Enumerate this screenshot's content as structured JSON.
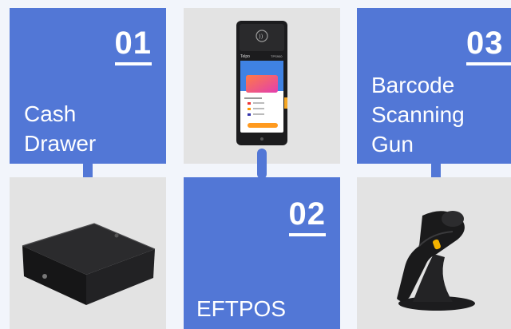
{
  "items": [
    {
      "number": "01",
      "title_lines": [
        "Cash",
        "Drawer"
      ],
      "image": "cash-drawer"
    },
    {
      "number": "02",
      "title_lines": [
        "EFTPOS"
      ],
      "image": "eftpos-terminal"
    },
    {
      "number": "03",
      "title_lines": [
        "Barcode",
        "Scanning",
        "Gun"
      ],
      "image": "barcode-scanner"
    }
  ],
  "device_screen": {
    "brand": "Telpo",
    "model": "TPS900"
  },
  "colors": {
    "accent": "#5277d6",
    "background": "#f2f5fb",
    "image_bg": "#e3e3e3"
  }
}
